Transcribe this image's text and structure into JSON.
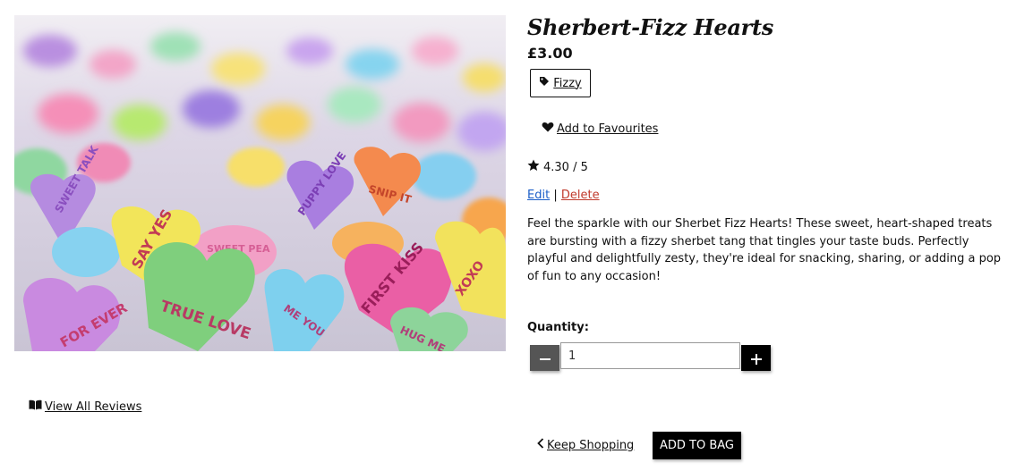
{
  "product": {
    "title": "Sherbert-Fizz Hearts",
    "price": "£3.00",
    "tag": "Fizzy",
    "favourite_label": " Add to Favourites",
    "rating": "4.30 / 5",
    "edit_label": "Edit",
    "separator": "|",
    "delete_label": "Delete",
    "description": "Feel the sparkle with our Sherbet Fizz Hearts! These sweet, heart-shaped treats are bursting with a fizzy sherbet tang that tingles your taste buds. Perfectly playful and delightfully zesty, they're ideal for snacking, sharing, or adding a pop of fun to any occasion!",
    "image": {
      "heart_texts": [
        "SWEET TALK",
        "PUPPY LOVE",
        "SNIP IT",
        "SAY YES",
        "SWEET PEA",
        "TRUE LOVE",
        "FIRST KISS",
        "XOXO",
        "FOR EVER",
        "ME YOU",
        "HUG ME"
      ]
    }
  },
  "quantity": {
    "label": "Quantity:",
    "value": "1",
    "minus_icon": "minus-icon",
    "plus_icon": "plus-icon"
  },
  "links": {
    "reviews_label": " View All Reviews",
    "keep_shopping_label": " Keep Shopping",
    "add_to_bag_label": "ADD TO BAG"
  },
  "colors": {
    "edit": "#1b5ec8",
    "delete": "#c0392b",
    "button_dark": "#000000",
    "button_grey": "#555555"
  }
}
